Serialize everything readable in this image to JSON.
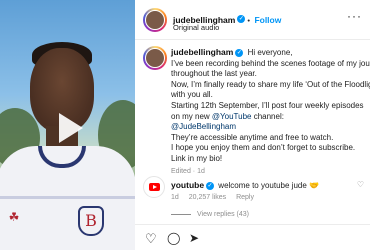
{
  "post": {
    "username": "judebellingham",
    "follow_label": "Follow",
    "separator": "•",
    "audio": "Original audio",
    "more_label": "···"
  },
  "caption": {
    "username": "judebellingham",
    "lines": [
      "Hi everyone,",
      "I’ve been recording behind the scenes footage of my journey",
      "throughout the last year.",
      "Now, I’m finally ready to share my life ‘Out of the Floodlights’",
      "with you all.",
      "Starting 12th September, I’ll post four weekly episodes",
      "on my new ",
      "They’re accessible anytime and free to watch.",
      "I hope you enjoy them and don’t forget to subscribe.",
      "Link in my bio!"
    ],
    "mention_youtube": "@YouTube",
    "channel_suffix": " channel:",
    "mention_jude": "@JudeBellingham",
    "meta": "Edited · 1d"
  },
  "comment": {
    "username": "youtube",
    "text": "welcome to youtube jude",
    "emoji": "🤝",
    "age": "1d",
    "likes": "20,257 likes",
    "reply_label": "Reply",
    "view_replies": "View replies (43)"
  },
  "video": {
    "badge_glyph": "☘",
    "crest_glyph": "B"
  },
  "icons": {
    "like": "♡",
    "comment": "◯",
    "share": "➤"
  }
}
